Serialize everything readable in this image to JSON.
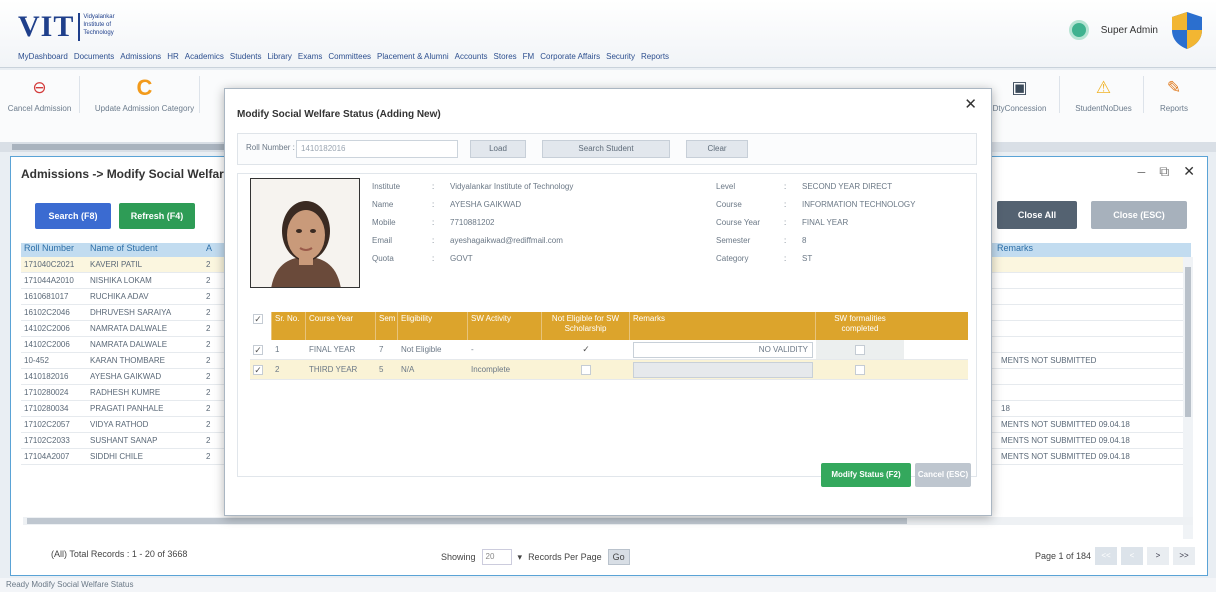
{
  "header": {
    "logo": "VIT",
    "logo_sub": "Vidyalankar Institute of Technology",
    "menu": [
      "MyDashboard",
      "Documents",
      "Admissions",
      "HR",
      "Academics",
      "Students",
      "Library",
      "Exams",
      "Committees",
      "Placement & Alumni",
      "Accounts",
      "Stores",
      "FM",
      "Corporate Affairs",
      "Security",
      "Reports"
    ],
    "user": "Super Admin"
  },
  "toolbar": {
    "items": [
      {
        "label": "Cancel Admission",
        "icon": "no-entry-icon",
        "color": "#d33b3b"
      },
      {
        "label": "Update Admission Category",
        "icon": "c-letter-icon",
        "color": "#f29a1b"
      },
      {
        "label": "DtyConcession",
        "icon": "monitor-icon",
        "color": "#3b4a5a"
      },
      {
        "label": "StudentNoDues",
        "icon": "warning-icon",
        "color": "#f0b429"
      },
      {
        "label": "Reports",
        "icon": "reports-icon",
        "color": "#e07a1e"
      }
    ]
  },
  "panel": {
    "breadcrumb": "Admissions -> Modify Social Welfare Status",
    "search_btn": "Search (F8)",
    "refresh_btn": "Refresh (F4)",
    "close_all": "Close All",
    "close_esc": "Close (ESC)",
    "grid_header": {
      "roll": "Roll Number",
      "name": "Name of Student",
      "a": "A",
      "remarks": "Remarks"
    },
    "rows": [
      {
        "roll": "171040C2021",
        "name": "KAVERI PATIL",
        "a": "2",
        "rem": ""
      },
      {
        "roll": "171044A2010",
        "name": "NISHIKA LOKAM",
        "a": "2",
        "rem": ""
      },
      {
        "roll": "1610681017",
        "name": "RUCHIKA ADAV",
        "a": "2",
        "rem": ""
      },
      {
        "roll": "16102C2046",
        "name": "DHRUVESH SARAIYA",
        "a": "2",
        "rem": ""
      },
      {
        "roll": "14102C2006",
        "name": "NAMRATA DALWALE",
        "a": "2",
        "rem": ""
      },
      {
        "roll": "14102C2006",
        "name": "NAMRATA DALWALE",
        "a": "2",
        "rem": ""
      },
      {
        "roll": "10-452",
        "name": "KARAN THOMBARE",
        "a": "2",
        "rem": "MENTS NOT SUBMITTED"
      },
      {
        "roll": "1410182016",
        "name": "AYESHA GAIKWAD",
        "a": "2",
        "rem": ""
      },
      {
        "roll": "1710280024",
        "name": "RADHESH KUMRE",
        "a": "2",
        "rem": ""
      },
      {
        "roll": "1710280034",
        "name": "PRAGATI PANHALE",
        "a": "2",
        "rem": "18"
      },
      {
        "roll": "17102C2057",
        "name": "VIDYA RATHOD",
        "a": "2",
        "rem": "MENTS NOT SUBMITTED 09.04.18"
      },
      {
        "roll": "17102C2033",
        "name": "SUSHANT SANAP",
        "a": "2",
        "rem": "MENTS NOT SUBMITTED 09.04.18"
      },
      {
        "roll": "17104A2007",
        "name": "SIDDHI CHILE",
        "a": "2",
        "rem": "MENTS NOT SUBMITTED 09.04.18"
      }
    ],
    "total": "(All) Total Records : 1 - 20 of 3668",
    "showing": "Showing",
    "per_page": "20",
    "records_per_page": "Records Per Page",
    "go": "Go",
    "page_info": "Page 1 of 184",
    "pager": [
      "<<",
      "<",
      ">",
      ">>"
    ]
  },
  "modal": {
    "title": "Modify Social Welfare Status (Adding New)",
    "roll_label": "Roll Number :",
    "roll_value": "1410182016",
    "load": "Load",
    "search_student": "Search Student",
    "clear": "Clear",
    "left_info": [
      {
        "k": "Institute",
        "v": "Vidyalankar Institute of Technology"
      },
      {
        "k": "Name",
        "v": "AYESHA GAIKWAD"
      },
      {
        "k": "Mobile",
        "v": "7710881202"
      },
      {
        "k": "Email",
        "v": "ayeshagaikwad@rediffmail.com"
      },
      {
        "k": "Quota",
        "v": "GOVT"
      }
    ],
    "right_info": [
      {
        "k": "Level",
        "v": "SECOND YEAR DIRECT"
      },
      {
        "k": "Course",
        "v": "INFORMATION TECHNOLOGY"
      },
      {
        "k": "Course Year",
        "v": "FINAL YEAR"
      },
      {
        "k": "Semester",
        "v": "8"
      },
      {
        "k": "Category",
        "v": "ST"
      }
    ],
    "table_head": [
      "Sr. No.",
      "Course Year",
      "Sem",
      "Eligibility",
      "SW Activity",
      "Not Eligible for SW Scholarship",
      "Remarks",
      "SW formalities completed"
    ],
    "rows": [
      {
        "sr": "1",
        "year": "FINAL YEAR",
        "sem": "7",
        "elig": "Not Eligible",
        "act": "-",
        "not_elig": true,
        "remarks": "NO VALIDITY",
        "done": false
      },
      {
        "sr": "2",
        "year": "THIRD YEAR",
        "sem": "5",
        "elig": "N/A",
        "act": "Incomplete",
        "not_elig": false,
        "remarks": "",
        "done": false
      }
    ],
    "modify_btn": "Modify Status (F2)",
    "cancel_btn": "Cancel (ESC)"
  },
  "status_bar": "Ready  Modify Social Welfare Status"
}
